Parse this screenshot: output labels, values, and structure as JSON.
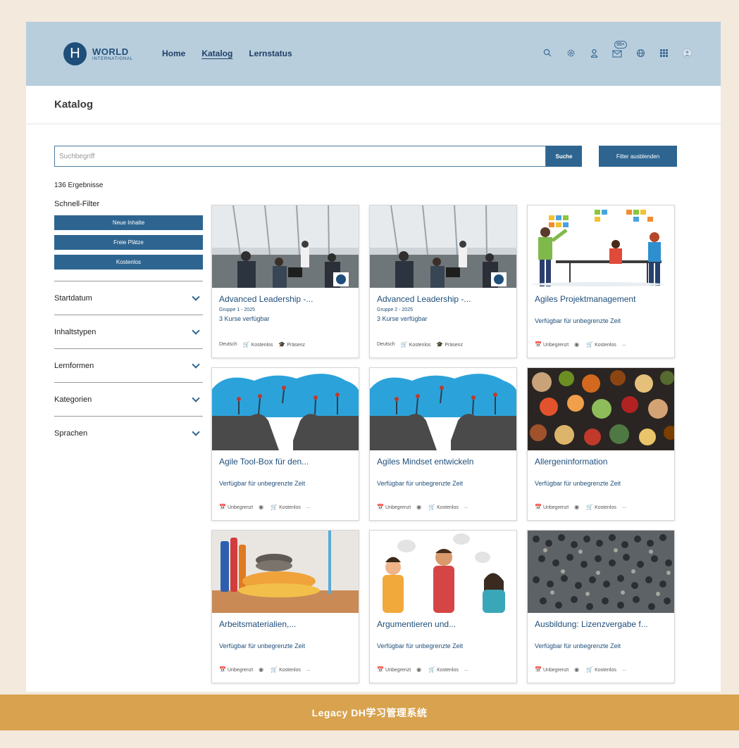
{
  "brand": {
    "logo_letter": "H",
    "name": "WORLD",
    "sub": "INTERNATIONAL"
  },
  "nav": [
    {
      "label": "Home"
    },
    {
      "label": "Katalog"
    },
    {
      "label": "Lernstatus"
    }
  ],
  "header_icons": {
    "notification_badge": "99+"
  },
  "page": {
    "title": "Katalog"
  },
  "search": {
    "placeholder": "Suchbegriff",
    "button": "Suche",
    "filter_toggle": "Filter ausblenden"
  },
  "results": {
    "count_text": "136 Ergebnisse"
  },
  "quick_filter": {
    "title": "Schnell-Filter",
    "buttons": [
      "Neue Inhalte",
      "Freie Plätze",
      "Kostenlos"
    ]
  },
  "facets": [
    "Startdatum",
    "Inhaltstypen",
    "Lernformen",
    "Kategorien",
    "Sprachen"
  ],
  "cards": [
    {
      "title": "Advanced Leadership -...",
      "subtitle": "Gruppe 1 - 2025",
      "availability": "3 Kurse verfügbar",
      "meta": [
        "Deutsch",
        "Kostenlos",
        "Präsenz"
      ]
    },
    {
      "title": "Advanced Leadership -...",
      "subtitle": "Gruppe 2 - 2025",
      "availability": "3 Kurse verfügbar",
      "meta": [
        "Deutsch",
        "Kostenlos",
        "Präsenz"
      ]
    },
    {
      "title": "Agiles Projektmanagement",
      "subtitle": "",
      "availability": "Verfügbar für unbegrenzte Zeit",
      "meta": [
        "Unbegrenzt",
        "",
        "Kostenlos",
        "..."
      ]
    },
    {
      "title": "Agile Tool-Box für den...",
      "subtitle": "",
      "availability": "Verfügbar für unbegrenzte Zeit",
      "meta": [
        "Unbegrenzt",
        "",
        "Kostenlos",
        "..."
      ]
    },
    {
      "title": "Agiles Mindset entwickeln",
      "subtitle": "",
      "availability": "Verfügbar für unbegrenzte Zeit",
      "meta": [
        "Unbegrenzt",
        "",
        "Kostenlos",
        "..."
      ]
    },
    {
      "title": "Allergeninformation",
      "subtitle": "",
      "availability": "Verfügbar für unbegrenzte Zeit",
      "meta": [
        "Unbegrenzt",
        "",
        "Kostenlos",
        "..."
      ]
    },
    {
      "title": "Arbeitsmaterialien,...",
      "subtitle": "",
      "availability": "Verfügbar für unbegrenzte Zeit",
      "meta": [
        "Unbegrenzt",
        "",
        "Kostenlos",
        "..."
      ]
    },
    {
      "title": "Argumentieren und...",
      "subtitle": "",
      "availability": "Verfügbar für unbegrenzte Zeit",
      "meta": [
        "Unbegrenzt",
        "",
        "Kostenlos",
        "..."
      ]
    },
    {
      "title": "Ausbildung: Lizenzvergabe f...",
      "subtitle": "",
      "availability": "Verfügbar für unbegrenzte Zeit",
      "meta": [
        "Unbegrenzt",
        "",
        "Kostenlos",
        "..."
      ]
    }
  ],
  "footer": {
    "caption": "Legacy DH学习管理系统"
  }
}
